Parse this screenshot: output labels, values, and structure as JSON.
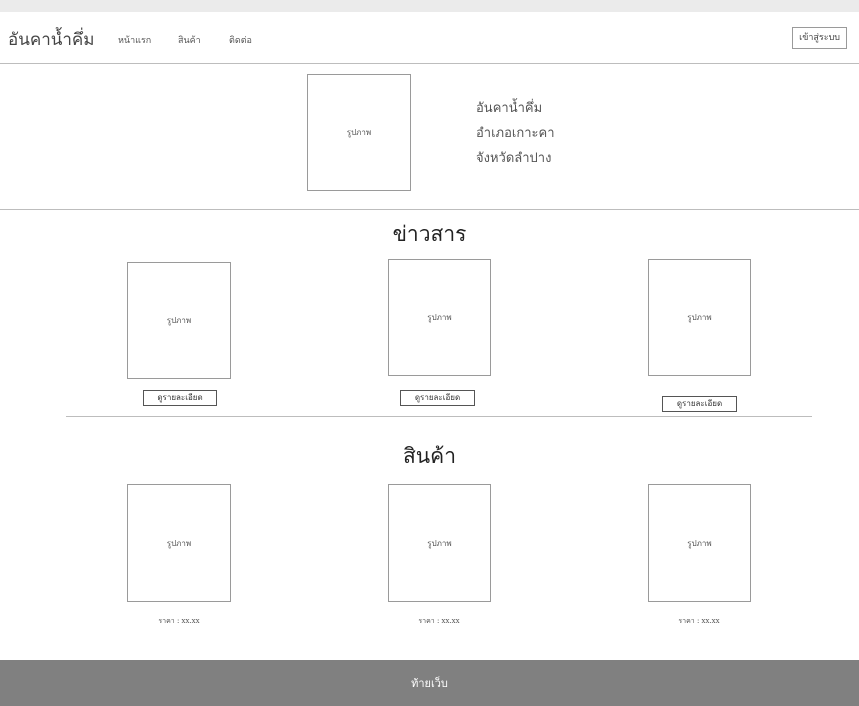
{
  "brand": "อันคาน้ำคึ่ม",
  "nav": {
    "home": "หน้าแรก",
    "products": "สินค้า",
    "contact": "ติดต่อ"
  },
  "login_label": "เข้าสู่ระบบ",
  "hero": {
    "image_label": "รูปภาพ",
    "lines": [
      "อันคาน้ำคึ่ม",
      "อำเภอเกาะคา",
      "จังหวัดลำปาง"
    ]
  },
  "news": {
    "title": "ข่าวสาร",
    "items": [
      {
        "image_label": "รูปภาพ",
        "button_label": "ดูรายละเอียด"
      },
      {
        "image_label": "รูปภาพ",
        "button_label": "ดูรายละเอียด"
      },
      {
        "image_label": "รูปภาพ",
        "button_label": "ดูรายละเอียด"
      }
    ]
  },
  "products": {
    "title": "สินค้า",
    "items": [
      {
        "image_label": "รูปภาพ",
        "price": "ราคา : xx.xx"
      },
      {
        "image_label": "รูปภาพ",
        "price": "ราคา : xx.xx"
      },
      {
        "image_label": "รูปภาพ",
        "price": "ราคา : xx.xx"
      }
    ]
  },
  "footer": "ท้ายเว็บ"
}
